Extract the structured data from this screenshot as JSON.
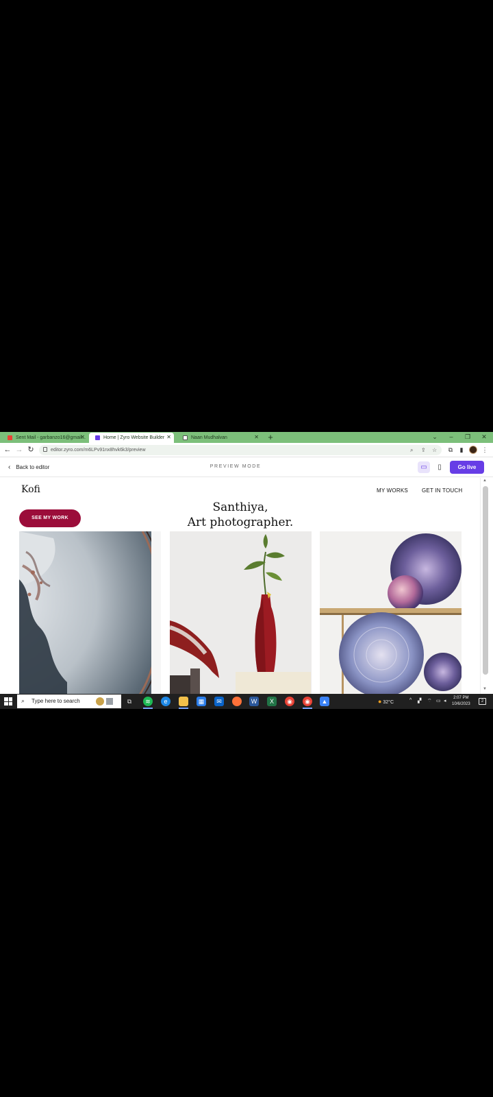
{
  "browser": {
    "tabs": [
      {
        "label": "Sent Mail - garbanzo16@gmail...",
        "active": false
      },
      {
        "label": "Home | Zyro Website Builder",
        "active": true
      },
      {
        "label": "Naan Mudhalvan",
        "active": false
      }
    ],
    "url": "editor.zyro.com/m6LPv91nx8hvk6k3/preview"
  },
  "preview_bar": {
    "back_label": "Back to editor",
    "mode_label": "PREVIEW MODE",
    "go_live_label": "Go live"
  },
  "site": {
    "logo": "Kofi",
    "nav": [
      "MY WORKS",
      "GET IN TOUCH"
    ],
    "cta_label": "SEE MY WORK",
    "hero_line1": "Santhiya,",
    "hero_line2": "Art photographer."
  },
  "taskbar": {
    "search_placeholder": "Type here to search",
    "weather": "32°C",
    "time": "2:07 PM",
    "date": "10/6/2023",
    "notifications": "2"
  },
  "colors": {
    "tab_strip": "#7cbf7a",
    "accent": "#673de6",
    "cta": "#9b0d3a"
  }
}
